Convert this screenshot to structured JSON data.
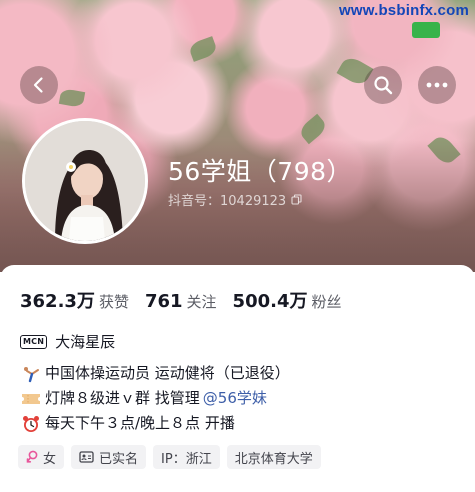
{
  "watermark": "www.bsbinfx.com",
  "header": {
    "nickname": "56学姐（798）",
    "douyin_id": "抖音号：10429123"
  },
  "stats": [
    {
      "value": "362.3万",
      "label": "获赞"
    },
    {
      "value": "761",
      "label": "关注"
    },
    {
      "value": "500.4万",
      "label": "粉丝"
    }
  ],
  "mcn": {
    "badge": "MCN",
    "name": "大海星辰"
  },
  "bio": {
    "line1": "中国体操运动员 运动健将（已退役）",
    "line2_prefix": "灯牌８级进ｖ群 找管理 ",
    "line2_mention": "@56学妹",
    "line3": "每天下午３点/晚上８点 开播"
  },
  "tags": [
    {
      "icon": "female-icon",
      "label": "女"
    },
    {
      "icon": "id-card-icon",
      "label": "已实名"
    },
    {
      "icon": "",
      "label": "IP：浙江"
    },
    {
      "icon": "",
      "label": "北京体育大学"
    }
  ],
  "colors": {
    "mention": "#3d5ea8",
    "watermark": "#1346b8",
    "tag_bg": "#f2f2f4"
  }
}
